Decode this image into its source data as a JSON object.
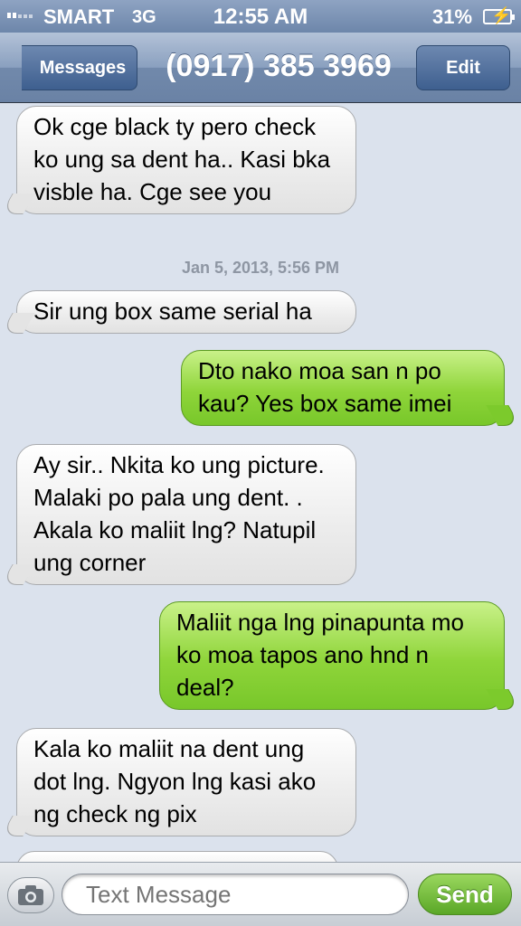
{
  "status_bar": {
    "carrier": "SMART",
    "network": "3G",
    "time": "12:55 AM",
    "battery": "31%",
    "icons": [
      "signal-bars-icon",
      "battery-charging-icon"
    ]
  },
  "nav": {
    "back_label": "Messages",
    "title": "(0917) 385 3969",
    "edit_label": "Edit"
  },
  "messages": [
    {
      "direction": "incoming",
      "text": "Ok cge black ty pero check ko ung sa dent ha.. Kasi bka visble ha. Cge see you"
    },
    {
      "type": "timestamp",
      "text": "Jan 5, 2013, 5:56 PM"
    },
    {
      "direction": "incoming",
      "text": "Sir ung box same serial ha"
    },
    {
      "direction": "outgoing",
      "text": "Dto nako moa san n po kau? Yes box same imei"
    },
    {
      "direction": "incoming",
      "text": "Ay sir.. Nkita ko ung picture. Malaki po pala ung dent. . Akala ko maliit lng? Natupil ung corner"
    },
    {
      "direction": "outgoing",
      "text": "Maliit nga lng pinapunta mo ko moa tapos ano hnd n deal?"
    },
    {
      "direction": "incoming",
      "text": "Kala ko maliit na dent ung dot lng. Ngyon lng kasi ako ng check ng pix"
    }
  ],
  "input": {
    "placeholder": "Text Message",
    "send_label": "Send"
  },
  "colors": {
    "incoming_bubble": "#e8e8e8",
    "outgoing_bubble": "#8fd53a",
    "nav_bar": "#7d93b4",
    "background": "#dbe2ed"
  }
}
